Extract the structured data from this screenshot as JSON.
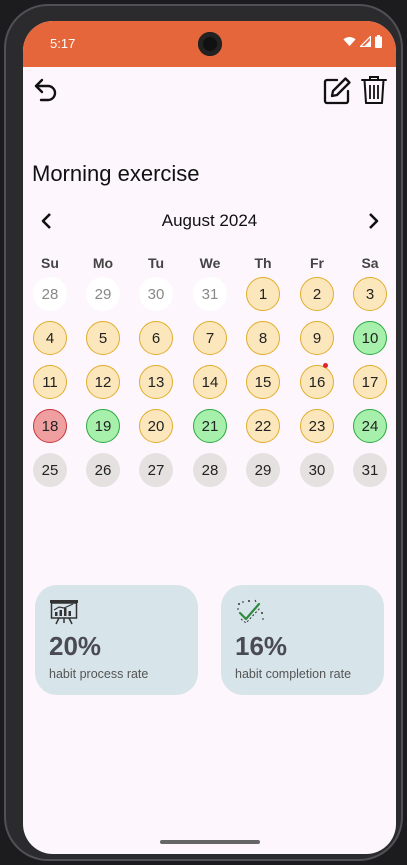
{
  "status_bar": {
    "time": "5:17"
  },
  "header": {
    "back_icon": "undo-icon",
    "edit_icon": "edit-icon",
    "delete_icon": "trash-icon"
  },
  "habit": {
    "title": "Morning exercise"
  },
  "calendar": {
    "month_label": "August 2024",
    "weekdays": [
      "Su",
      "Mo",
      "Tu",
      "We",
      "Th",
      "Fr",
      "Sa"
    ],
    "days": [
      {
        "label": "28",
        "status": "outside"
      },
      {
        "label": "29",
        "status": "outside"
      },
      {
        "label": "30",
        "status": "outside"
      },
      {
        "label": "31",
        "status": "outside"
      },
      {
        "label": "1",
        "status": "yellow"
      },
      {
        "label": "2",
        "status": "yellow"
      },
      {
        "label": "3",
        "status": "yellow"
      },
      {
        "label": "4",
        "status": "yellow"
      },
      {
        "label": "5",
        "status": "yellow"
      },
      {
        "label": "6",
        "status": "yellow"
      },
      {
        "label": "7",
        "status": "yellow"
      },
      {
        "label": "8",
        "status": "yellow"
      },
      {
        "label": "9",
        "status": "yellow"
      },
      {
        "label": "10",
        "status": "green"
      },
      {
        "label": "11",
        "status": "yellow"
      },
      {
        "label": "12",
        "status": "yellow"
      },
      {
        "label": "13",
        "status": "yellow"
      },
      {
        "label": "14",
        "status": "yellow"
      },
      {
        "label": "15",
        "status": "yellow"
      },
      {
        "label": "16",
        "status": "yellow",
        "today": true
      },
      {
        "label": "17",
        "status": "yellow"
      },
      {
        "label": "18",
        "status": "red"
      },
      {
        "label": "19",
        "status": "green"
      },
      {
        "label": "20",
        "status": "yellow"
      },
      {
        "label": "21",
        "status": "green"
      },
      {
        "label": "22",
        "status": "yellow"
      },
      {
        "label": "23",
        "status": "yellow"
      },
      {
        "label": "24",
        "status": "green"
      },
      {
        "label": "25",
        "status": "grey"
      },
      {
        "label": "26",
        "status": "grey"
      },
      {
        "label": "27",
        "status": "grey"
      },
      {
        "label": "28",
        "status": "grey"
      },
      {
        "label": "29",
        "status": "grey"
      },
      {
        "label": "30",
        "status": "grey"
      },
      {
        "label": "31",
        "status": "grey"
      }
    ],
    "colors": {
      "yellow": "#fbe7bb",
      "green": "#a7f0ab",
      "red": "#f09fa0",
      "grey": "#e4e1e0",
      "today_dot": "#e0262a"
    }
  },
  "stats": {
    "process": {
      "icon": "presentation-chart-icon",
      "value": "20%",
      "label": "habit process rate"
    },
    "completion": {
      "icon": "checkmark-badge-icon",
      "value": "16%",
      "label": "habit completion rate"
    }
  },
  "theme": {
    "status_bar_color": "#e5663a",
    "background": "#fdf6fc",
    "card_color": "#d7e4ea"
  }
}
